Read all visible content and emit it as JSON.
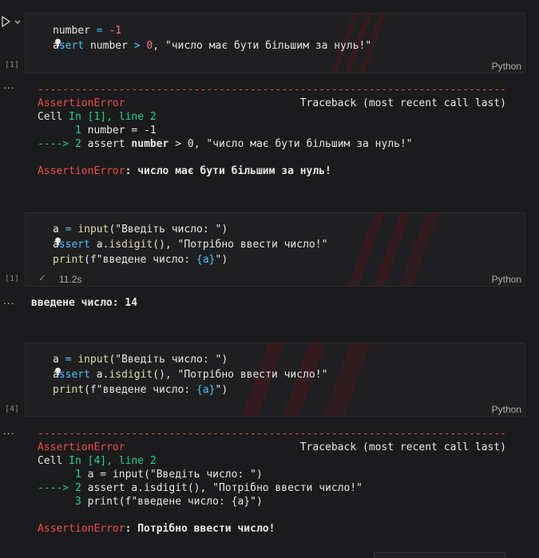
{
  "run_icon": "play-icon",
  "cells": [
    {
      "exec": "[1]",
      "lang": "Python",
      "lines": [
        {
          "segments": [
            {
              "t": "number",
              "c": "var"
            },
            {
              "t": " = ",
              "c": "op"
            },
            {
              "t": "-1",
              "c": "num"
            }
          ]
        },
        {
          "segments": [
            {
              "t": "a",
              "c": "var"
            },
            {
              "t": "sert",
              "c": "kw"
            },
            {
              "t": " number ",
              "c": "var"
            },
            {
              "t": ">",
              "c": "op"
            },
            {
              "t": " 0",
              "c": "num"
            },
            {
              "t": ", \"число має бути більшим за нуль!\"",
              "c": "str"
            }
          ]
        }
      ]
    },
    {
      "exec": "[1]",
      "lang": "Python",
      "status": "✓",
      "time": "11.2s",
      "lines": [
        {
          "segments": [
            {
              "t": "a",
              "c": "var"
            },
            {
              "t": " = ",
              "c": "op"
            },
            {
              "t": "input",
              "c": "fn"
            },
            {
              "t": "(\"Введіть число: \")",
              "c": "str"
            }
          ]
        },
        {
          "segments": [
            {
              "t": "a",
              "c": "var"
            },
            {
              "t": "ssert",
              "c": "kw"
            },
            {
              "t": " a.",
              "c": "var"
            },
            {
              "t": "isdigit",
              "c": "fn"
            },
            {
              "t": "(), \"Потрібно ввести число!\"",
              "c": "str"
            }
          ]
        },
        {
          "segments": [
            {
              "t": "print",
              "c": "fn"
            },
            {
              "t": "(f\"введене число: ",
              "c": "str"
            },
            {
              "t": "{a}",
              "c": "kw"
            },
            {
              "t": "\")",
              "c": "str"
            }
          ]
        }
      ]
    },
    {
      "exec": "[4]",
      "lang": "Python",
      "lines": [
        {
          "segments": [
            {
              "t": "a",
              "c": "var"
            },
            {
              "t": " = ",
              "c": "op"
            },
            {
              "t": "input",
              "c": "fn"
            },
            {
              "t": "(\"Введіть число: \")",
              "c": "str"
            }
          ]
        },
        {
          "segments": [
            {
              "t": "a",
              "c": "var"
            },
            {
              "t": "ssert",
              "c": "kw"
            },
            {
              "t": " a.",
              "c": "var"
            },
            {
              "t": "isdigit",
              "c": "fn"
            },
            {
              "t": "(), \"Потрібно ввести число!\"",
              "c": "str"
            }
          ]
        },
        {
          "segments": [
            {
              "t": "print",
              "c": "fn"
            },
            {
              "t": "(f\"введене число: ",
              "c": "str"
            },
            {
              "t": "{a}",
              "c": "kw"
            },
            {
              "t": "\")",
              "c": "str"
            }
          ]
        }
      ]
    }
  ],
  "outputs": [
    {
      "dots": "...",
      "lines": [
        {
          "segments": [
            {
              "t": "---------------------------------------------------------------------------",
              "c": "red"
            }
          ]
        },
        {
          "segments": [
            {
              "t": "AssertionError",
              "c": "red"
            },
            {
              "t": "                            Traceback (most recent call last)",
              "c": "plain"
            }
          ]
        },
        {
          "segments": [
            {
              "t": "Cell ",
              "c": "plain"
            },
            {
              "t": "In [1], line 2",
              "c": "green"
            }
          ]
        },
        {
          "segments": [
            {
              "t": "      ",
              "c": "plain"
            },
            {
              "t": "1",
              "c": "green"
            },
            {
              "t": " number = -1",
              "c": "plain"
            }
          ]
        },
        {
          "segments": [
            {
              "t": "----> 2",
              "c": "green"
            },
            {
              "t": " assert ",
              "c": "plain"
            },
            {
              "t": "number",
              "c": "bold"
            },
            {
              "t": " > 0, \"число має бути більшим за нуль!\"",
              "c": "plain"
            }
          ]
        },
        {
          "segments": [
            {
              "t": "",
              "c": "plain"
            }
          ]
        },
        {
          "segments": [
            {
              "t": "AssertionError",
              "c": "red"
            },
            {
              "t": ": число має бути більшим за нуль!",
              "c": "bold"
            }
          ]
        }
      ]
    },
    {
      "dots": "...",
      "lines": [
        {
          "segments": [
            {
              "t": "введене число: 14",
              "c": "bold"
            }
          ]
        }
      ]
    },
    {
      "dots": "...",
      "lines": [
        {
          "segments": [
            {
              "t": "---------------------------------------------------------------------------",
              "c": "red"
            }
          ]
        },
        {
          "segments": [
            {
              "t": "AssertionError",
              "c": "red"
            },
            {
              "t": "                            Traceback (most recent call last)",
              "c": "plain"
            }
          ]
        },
        {
          "segments": [
            {
              "t": "Cell ",
              "c": "plain"
            },
            {
              "t": "In [4], line 2",
              "c": "green"
            }
          ]
        },
        {
          "segments": [
            {
              "t": "      ",
              "c": "plain"
            },
            {
              "t": "1",
              "c": "green"
            },
            {
              "t": " a = input(\"Введіть число: \")",
              "c": "plain"
            }
          ]
        },
        {
          "segments": [
            {
              "t": "----> 2",
              "c": "green"
            },
            {
              "t": " assert a.isdigit(), \"Потрібно ввести число!\"",
              "c": "plain"
            }
          ]
        },
        {
          "segments": [
            {
              "t": "      ",
              "c": "plain"
            },
            {
              "t": "3",
              "c": "green"
            },
            {
              "t": " print(f\"введене число: {a}\")",
              "c": "plain"
            }
          ]
        },
        {
          "segments": [
            {
              "t": "",
              "c": "plain"
            }
          ]
        },
        {
          "segments": [
            {
              "t": "AssertionError",
              "c": "red"
            },
            {
              "t": ": Потрібно ввести число!",
              "c": "bold"
            }
          ]
        }
      ]
    }
  ]
}
